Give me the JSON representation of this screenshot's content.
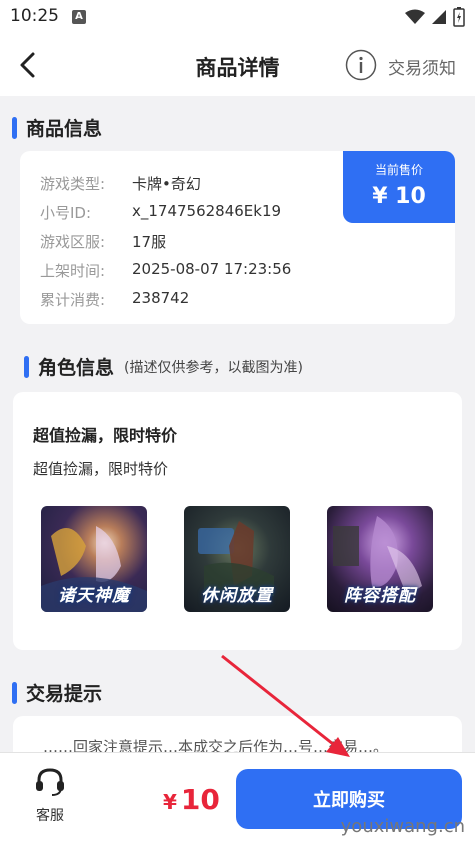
{
  "status_bar": {
    "time": "10:25",
    "badge": "A"
  },
  "header": {
    "title": "商品详情",
    "notice_label": "交易须知"
  },
  "product_info": {
    "section_title": "商品信息",
    "rows": [
      {
        "label": "游戏类型:",
        "value": "卡牌•奇幻"
      },
      {
        "label": "小号ID:",
        "value": "x_1747562846Ek19"
      },
      {
        "label": "游戏区服:",
        "value": "17服"
      },
      {
        "label": "上架时间:",
        "value": "2025-08-07 17:23:56"
      },
      {
        "label": "累计消费:",
        "value": "238742"
      }
    ],
    "price_label": "当前售价",
    "price": "¥ 10"
  },
  "role_info": {
    "section_title": "角色信息",
    "section_note": "(描述仅供参考，以截图为准)",
    "headline": "超值捡漏，限时特价",
    "description": "超值捡漏，限时特价",
    "screenshots": [
      {
        "label": "诸天神魔"
      },
      {
        "label": "休闲放置"
      },
      {
        "label": "阵容搭配"
      }
    ]
  },
  "trade_tips": {
    "section_title": "交易提示",
    "line": "……回家注意提示…本成交之后作为…号…交易…。"
  },
  "bottom_bar": {
    "service_label": "客服",
    "currency": "¥",
    "price": "10",
    "buy_label": "立即购买"
  },
  "watermark": "youxiwang.cn",
  "colors": {
    "accent": "#2f6ff3",
    "price_red": "#e8253a",
    "background": "#f2f2f4"
  }
}
